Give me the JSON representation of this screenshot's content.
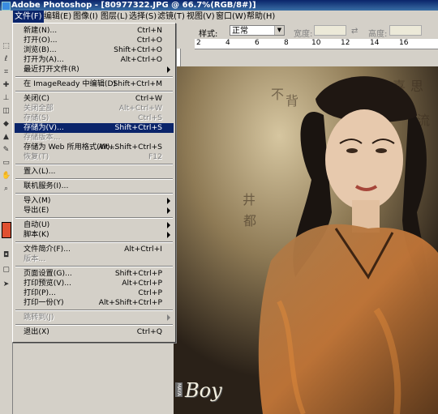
{
  "window": {
    "title": "Adobe Photoshop - [80977322.JPG @ 66.7%(RGB/8#)]"
  },
  "menubar": [
    {
      "label": "文件(F)",
      "active": true
    },
    {
      "label": "编辑(E)"
    },
    {
      "label": "图像(I)"
    },
    {
      "label": "图层(L)"
    },
    {
      "label": "选择(S)"
    },
    {
      "label": "滤镜(T)"
    },
    {
      "label": "视图(V)"
    },
    {
      "label": "窗口(W)"
    },
    {
      "label": "帮助(H)"
    }
  ],
  "options_bar": {
    "style_label": "样式:",
    "style_value": "正常",
    "width_label": "宽度:",
    "height_label": "高度:"
  },
  "ruler_top": [
    "2",
    "4",
    "6",
    "8",
    "10",
    "12",
    "14",
    "16"
  ],
  "file_menu": [
    {
      "label": "新建(N)...",
      "shortcut": "Ctrl+N"
    },
    {
      "label": "打开(O)...",
      "shortcut": "Ctrl+O"
    },
    {
      "label": "浏览(B)...",
      "shortcut": "Shift+Ctrl+O"
    },
    {
      "label": "打开为(A)...",
      "shortcut": "Alt+Ctrl+O"
    },
    {
      "label": "最近打开文件(R)",
      "shortcut": "",
      "submenu": true
    },
    {
      "separator": true
    },
    {
      "label": "在 ImageReady 中编辑(D)",
      "shortcut": "Shift+Ctrl+M"
    },
    {
      "separator": true
    },
    {
      "label": "关闭(C)",
      "shortcut": "Ctrl+W"
    },
    {
      "label": "关闭全部",
      "shortcut": "Alt+Ctrl+W",
      "disabled": true
    },
    {
      "label": "存储(S)",
      "shortcut": "Ctrl+S",
      "disabled": true
    },
    {
      "label": "存储为(V)...",
      "shortcut": "Shift+Ctrl+S",
      "highlighted": true
    },
    {
      "label": "存储版本...",
      "shortcut": "",
      "disabled": true
    },
    {
      "label": "存储为 Web 所用格式(W)...",
      "shortcut": "Alt+Shift+Ctrl+S"
    },
    {
      "label": "恢复(T)",
      "shortcut": "F12",
      "disabled": true
    },
    {
      "separator": true
    },
    {
      "label": "置入(L)...",
      "shortcut": ""
    },
    {
      "separator": true
    },
    {
      "label": "联机服务(I)...",
      "shortcut": ""
    },
    {
      "separator": true
    },
    {
      "label": "导入(M)",
      "shortcut": "",
      "submenu": true
    },
    {
      "label": "导出(E)",
      "shortcut": "",
      "submenu": true
    },
    {
      "separator": true
    },
    {
      "label": "自动(U)",
      "shortcut": "",
      "submenu": true
    },
    {
      "label": "脚本(K)",
      "shortcut": "",
      "submenu": true
    },
    {
      "separator": true
    },
    {
      "label": "文件简介(F)...",
      "shortcut": "Alt+Ctrl+I"
    },
    {
      "label": "版本...",
      "shortcut": "",
      "disabled": true
    },
    {
      "separator": true
    },
    {
      "label": "页面设置(G)...",
      "shortcut": "Shift+Ctrl+P"
    },
    {
      "label": "打印预览(V)...",
      "shortcut": "Alt+Ctrl+P"
    },
    {
      "label": "打印(P)...",
      "shortcut": "Ctrl+P"
    },
    {
      "label": "打印一份(Y)",
      "shortcut": "Alt+Shift+Ctrl+P"
    },
    {
      "separator": true
    },
    {
      "label": "跳转到(J)",
      "shortcut": "",
      "submenu": true,
      "disabled": true
    },
    {
      "separator": true
    },
    {
      "label": "退出(X)",
      "shortcut": "Ctrl+Q"
    }
  ],
  "photo": {
    "caption": "Boy",
    "brand": "MAYA"
  },
  "colors": {
    "highlight": "#0a246a",
    "chrome": "#d4d0c8",
    "title_start": "#0a246a",
    "title_end": "#3a6ea5"
  }
}
